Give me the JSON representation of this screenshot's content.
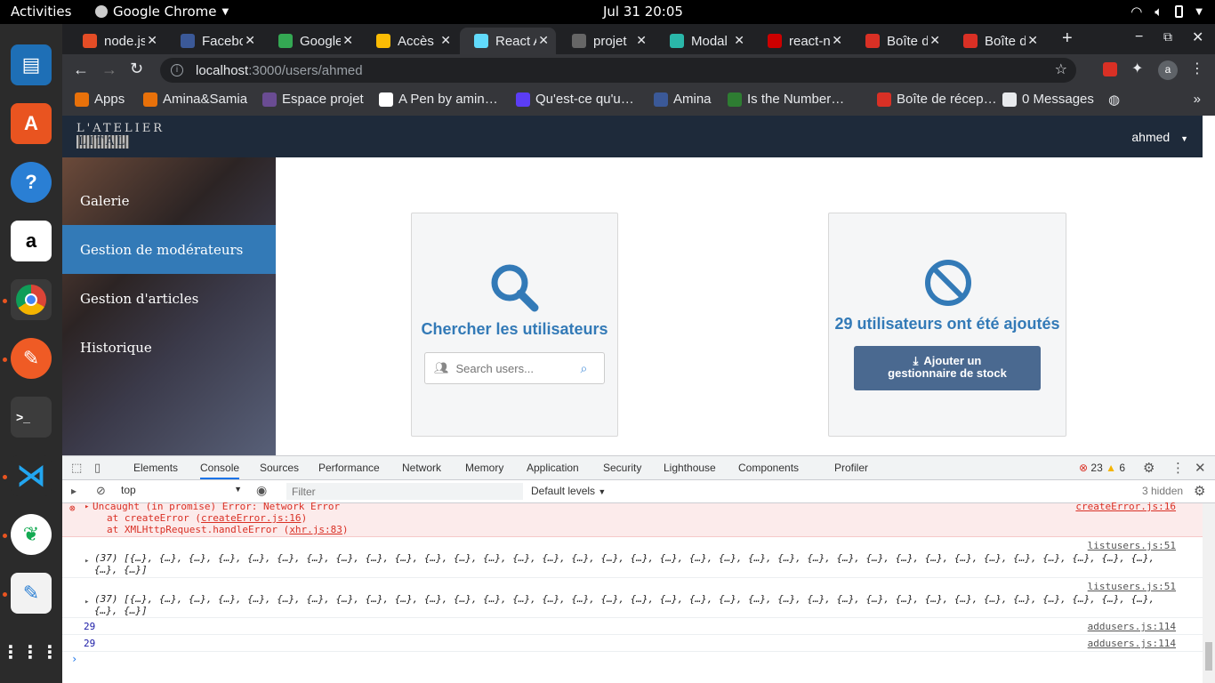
{
  "system": {
    "activities": "Activities",
    "app_name": "Google Chrome",
    "clock": "Jul 31  20:05"
  },
  "tabs": [
    {
      "title": "node.js",
      "icon_color": "#e44d26",
      "icon": "node-icon"
    },
    {
      "title": "Facebook",
      "icon_color": "#3b5998",
      "icon": "facebook-icon"
    },
    {
      "title": "Google",
      "icon_color": "#34a853",
      "icon": "google-drive-icon"
    },
    {
      "title": "Accès",
      "icon_color": "#fbbc04",
      "icon": "google-drive-icon"
    },
    {
      "title": "React A",
      "icon_color": "#61dafb",
      "icon": "react-icon"
    },
    {
      "title": "projet",
      "icon_color": "#666666",
      "icon": "github-icon"
    },
    {
      "title": "Modal",
      "icon_color": "#2ab7a9",
      "icon": "modal-icon"
    },
    {
      "title": "react-n",
      "icon_color": "#cc0000",
      "icon": "npm-icon"
    },
    {
      "title": "Boîte d",
      "icon_color": "#d93025",
      "icon": "gmail-icon"
    },
    {
      "title": "Boîte d",
      "icon_color": "#d93025",
      "icon": "gmail-icon"
    }
  ],
  "address": {
    "host": "localhost",
    "path": ":3000/users/ahmed"
  },
  "bookmarks": [
    {
      "label": "Apps",
      "color": "#e8710a"
    },
    {
      "label": "Amina&Samia",
      "color": "#e8710a"
    },
    {
      "label": "Espace projet",
      "color": "#6a4c93"
    },
    {
      "label": "A Pen by amin…",
      "color": "#ffffff"
    },
    {
      "label": "Qu'est-ce qu'u…",
      "color": "#5b3df5"
    },
    {
      "label": "Amina",
      "color": "#3b5998"
    },
    {
      "label": "Is the Number…",
      "color": "#2e7d32"
    },
    {
      "label": "Boîte de récep…",
      "color": "#d93025"
    },
    {
      "label": "0 Messages",
      "color": "#e8eaed"
    }
  ],
  "site": {
    "logo_line1": "L'ATELIER",
    "logo_line2": "LITAL",
    "user": "ahmed",
    "sidebar": [
      {
        "label": "Galerie"
      },
      {
        "label": "Gestion de modérateurs"
      },
      {
        "label": "Gestion d'articles"
      },
      {
        "label": "Historique"
      }
    ],
    "search_card_title": "Chercher les utilisateurs",
    "search_placeholder": "Search users...",
    "count_card_title": "29 utilisateurs ont été ajoutés",
    "add_button_line1": "Ajouter un",
    "add_button_line2": "gestionnaire de stock"
  },
  "devtools": {
    "tabs": [
      "Elements",
      "Console",
      "Sources",
      "Performance",
      "Network",
      "Memory",
      "Application",
      "Security",
      "Lighthouse",
      "Components",
      "Profiler"
    ],
    "errors": "23",
    "warnings": "6",
    "context": "top",
    "filter_placeholder": "Filter",
    "levels": "Default levels",
    "hidden": "3 hidden"
  },
  "console": {
    "error_line1": "Uncaught (in promise) Error: Network Error",
    "error_line2a": "at createError (",
    "error_line2b": "createError.js:16",
    "error_line3a": "at XMLHttpRequest.handleError (",
    "error_line3b": "xhr.js:83",
    "error_src": "createError.js:16",
    "array_line1": "(37) [{…}, {…}, {…}, {…}, {…}, {…}, {…}, {…}, {…}, {…}, {…}, {…}, {…}, {…}, {…}, {…}, {…}, {…}, {…}, {…}, {…}, {…}, {…}, {…}, {…}, {…}, {…}, {…}, {…}, {…}, {…}, {…}, {…}, {…}, {…},",
    "array_line2": "{…}, {…}]",
    "array_src": "listusers.js:51",
    "num": "29",
    "num_src": "addusers.js:114"
  }
}
